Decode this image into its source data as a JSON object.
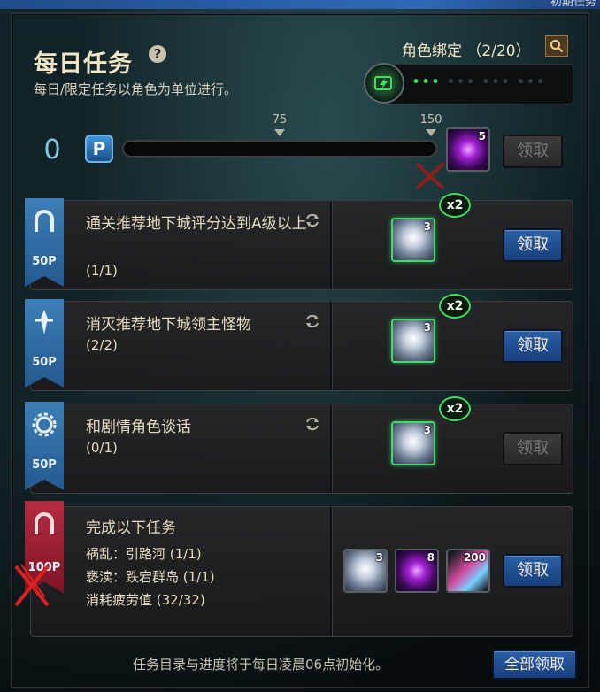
{
  "top_strip": {
    "text": "初期任务"
  },
  "header": {
    "title": "每日任务",
    "subtitle": "每日/限定任务以角色为单位进行。",
    "bind_label": "角色绑定 （2/20）",
    "slots_active": "•••",
    "slots_inactive": "••• ••• •••"
  },
  "progress": {
    "current_points": "0",
    "milestone_1": "75",
    "milestone_2": "150",
    "reward_count": "5",
    "claim_label": "领取"
  },
  "tasks": [
    {
      "title": "通关推荐地下城评分达到A级以上",
      "progress": "(1/1)",
      "points": "50P",
      "multiplier": "x2",
      "reward_count": "3",
      "claim_label": "领取",
      "claim_enabled": true
    },
    {
      "title": "消灭推荐地下城领主怪物",
      "progress": "(2/2)",
      "points": "50P",
      "multiplier": "x2",
      "reward_count": "3",
      "claim_label": "领取",
      "claim_enabled": true
    },
    {
      "title": "和剧情角色谈话",
      "progress": "(0/1)",
      "points": "50P",
      "multiplier": "x2",
      "reward_count": "3",
      "claim_label": "领取",
      "claim_enabled": false
    },
    {
      "title": "完成以下任务",
      "lines": [
        "祸乱：引路河 (1/1)",
        "亵渎：跌宕群岛 (1/1)",
        "消耗疲劳值 (32/32)"
      ],
      "points": "100P",
      "reward_counts": [
        "3",
        "8",
        "200"
      ],
      "claim_label": "领取",
      "claim_enabled": true
    }
  ],
  "footer": {
    "note": "任务目录与进度将于每日凌晨06点初始化。",
    "claim_all_label": "全部领取"
  },
  "colors": {
    "accent_green": "#3ee05e",
    "button_blue": "#2b5fa8",
    "banner_blue": "#3d7fb8",
    "banner_red": "#b52b3f"
  }
}
